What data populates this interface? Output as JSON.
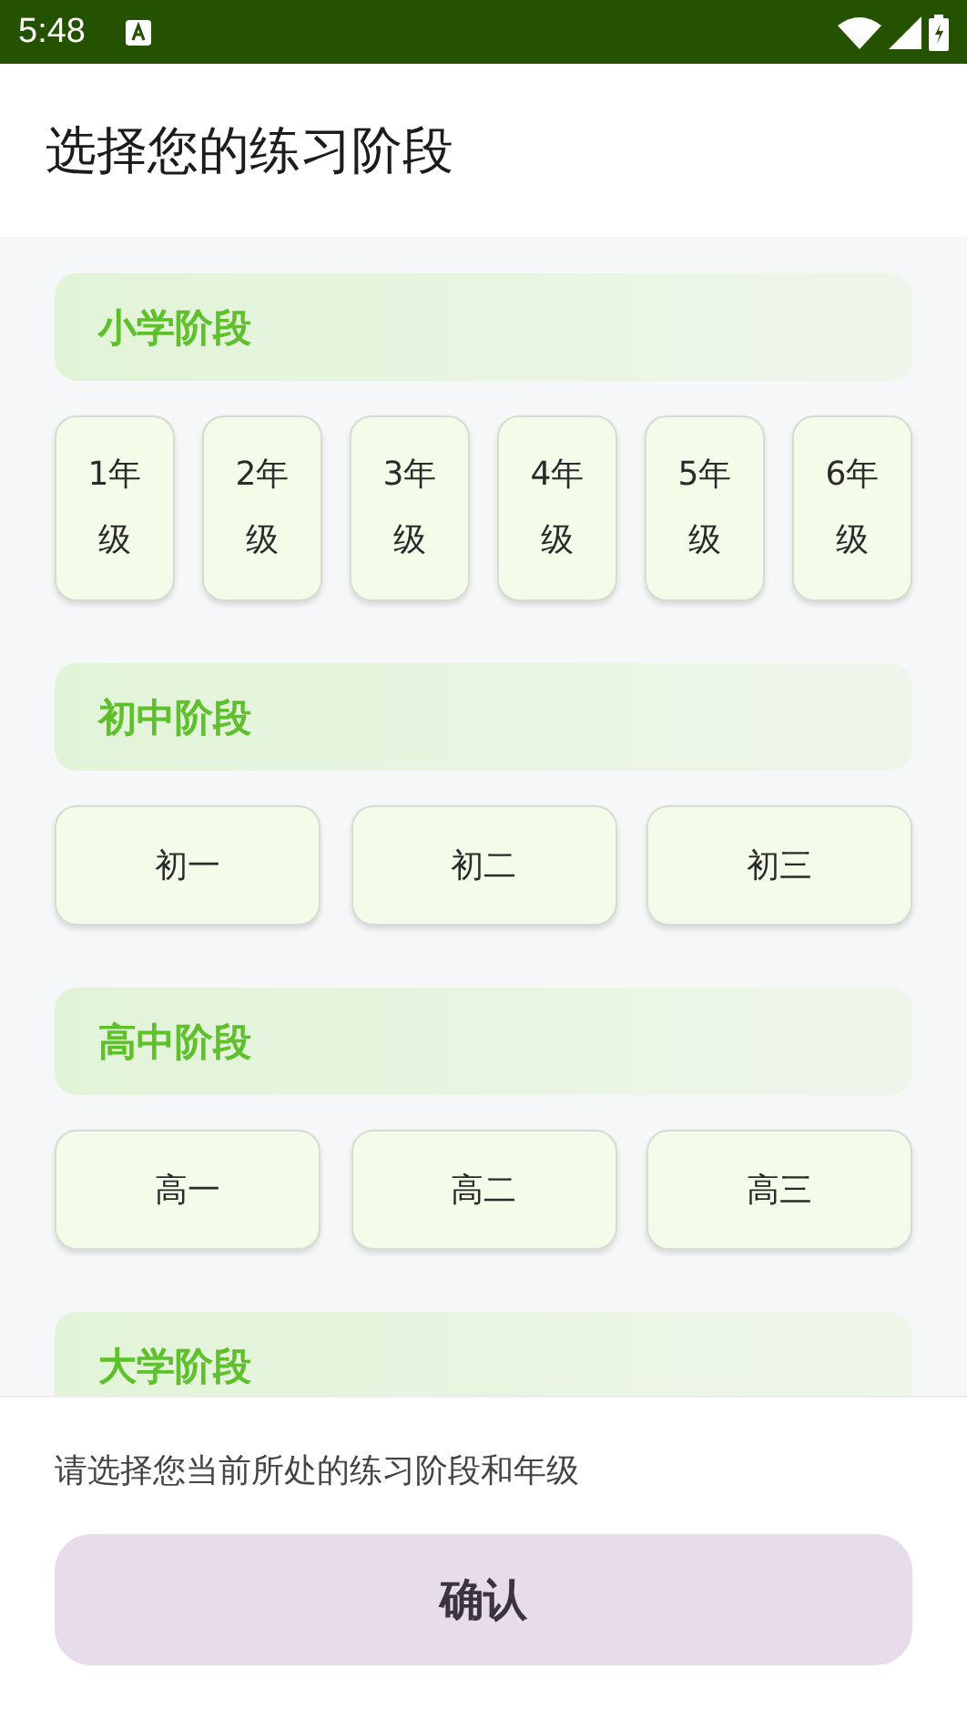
{
  "status_bar": {
    "time": "5:48"
  },
  "title": "选择您的练习阶段",
  "sections": [
    {
      "title": "小学阶段",
      "kind": "narrow",
      "grades": [
        {
          "label": "1年级",
          "selected": false
        },
        {
          "label": "2年级",
          "selected": false
        },
        {
          "label": "3年级",
          "selected": false
        },
        {
          "label": "4年级",
          "selected": false
        },
        {
          "label": "5年级",
          "selected": false
        },
        {
          "label": "6年级",
          "selected": false
        }
      ]
    },
    {
      "title": "初中阶段",
      "kind": "wide",
      "grades": [
        {
          "label": "初一",
          "selected": false
        },
        {
          "label": "初二",
          "selected": false
        },
        {
          "label": "初三",
          "selected": false
        }
      ]
    },
    {
      "title": "高中阶段",
      "kind": "wide",
      "grades": [
        {
          "label": "高一",
          "selected": false
        },
        {
          "label": "高二",
          "selected": false
        },
        {
          "label": "高三",
          "selected": false
        }
      ]
    },
    {
      "title": "大学阶段"
    }
  ],
  "hint": "请选择您当前所处的练习阶段和年级",
  "confirm_button": "确认"
}
